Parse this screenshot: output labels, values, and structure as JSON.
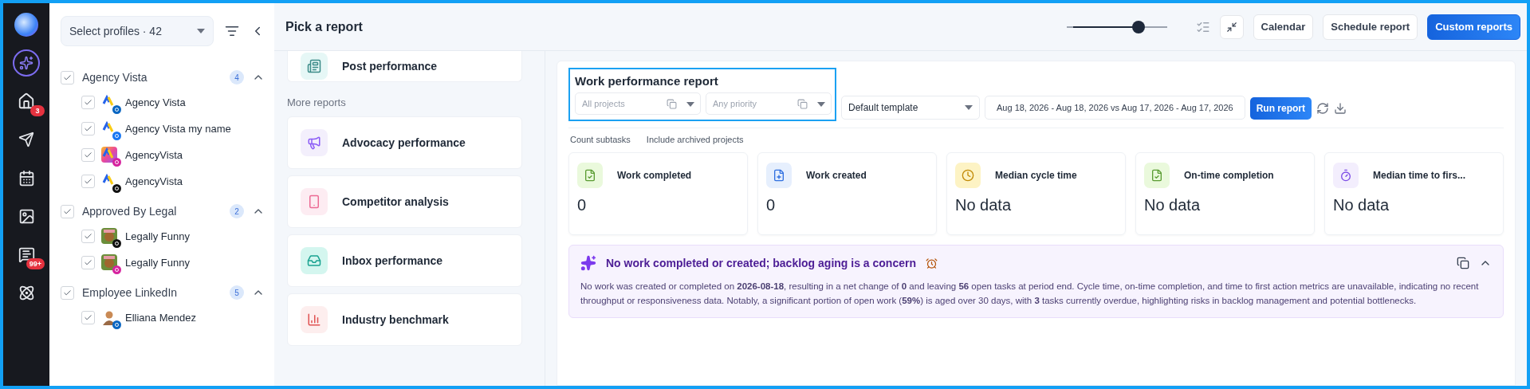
{
  "nav_rail": {
    "items": [
      {
        "kind": "logo",
        "selected": false
      },
      {
        "kind": "assistant",
        "selected": true
      },
      {
        "kind": "home",
        "selected": false,
        "badge": "3"
      },
      {
        "kind": "publish",
        "selected": false
      },
      {
        "kind": "calendar",
        "selected": false
      },
      {
        "kind": "media",
        "selected": false
      },
      {
        "kind": "inbox",
        "selected": false,
        "badge": "99+"
      },
      {
        "kind": "integrations",
        "selected": false
      }
    ]
  },
  "profiles": {
    "selector": "Select profiles · 42",
    "groups": [
      {
        "name": "Agency Vista",
        "count": "4",
        "checked": true,
        "expanded": true,
        "children": [
          {
            "name": "Agency Vista",
            "checked": true,
            "avatar": {
              "kind": "logo"
            },
            "network": {
              "kind": "linkedin"
            }
          },
          {
            "name": "Agency Vista my name",
            "checked": true,
            "avatar": {
              "kind": "logo"
            },
            "network": {
              "kind": "facebook"
            }
          },
          {
            "name": "AgencyVista",
            "checked": true,
            "avatar": {
              "kind": "gradient"
            },
            "network": {
              "kind": "instagram"
            }
          },
          {
            "name": "AgencyVista",
            "checked": true,
            "avatar": {
              "kind": "logo"
            },
            "network": {
              "kind": "x"
            }
          }
        ]
      },
      {
        "name": "Approved By Legal",
        "count": "2",
        "checked": true,
        "expanded": true,
        "children": [
          {
            "name": "Legally Funny",
            "checked": true,
            "avatar": {
              "kind": "photo"
            },
            "network": {
              "kind": "tiktok"
            }
          },
          {
            "name": "Legally Funny",
            "checked": true,
            "avatar": {
              "kind": "photo"
            },
            "network": {
              "kind": "instagram"
            }
          }
        ]
      },
      {
        "name": "Employee LinkedIn",
        "count": "5",
        "checked": true,
        "expanded": true,
        "children": [
          {
            "name": "Elliana Mendez",
            "checked": true,
            "avatar": {
              "kind": "person"
            },
            "network": {
              "kind": "linkedin"
            }
          }
        ]
      }
    ]
  },
  "header": {
    "title": "Pick a report",
    "zoom": {
      "level": 0.75
    },
    "buttons": [
      {
        "label": "Calendar",
        "kind": "secondary"
      },
      {
        "label": "Schedule report",
        "kind": "secondary"
      },
      {
        "label": "Custom reports",
        "kind": "primary"
      }
    ]
  },
  "report_list": {
    "top_report": {
      "title": "Post performance",
      "kind": "post"
    },
    "section": "More reports",
    "reports": [
      {
        "title": "Advocacy performance",
        "kind": "advocacy"
      },
      {
        "title": "Competitor analysis",
        "kind": "competitor"
      },
      {
        "title": "Inbox performance",
        "kind": "inbox"
      },
      {
        "title": "Industry benchmark",
        "kind": "benchmark"
      }
    ]
  },
  "report": {
    "title": "Work performance report",
    "filters": [
      {
        "placeholder": "All projects"
      },
      {
        "placeholder": "Any priority"
      }
    ],
    "template": "Default template",
    "date_range": "Aug 18, 2026 - Aug 18, 2026 vs Aug 17, 2026 - Aug 17, 2026",
    "run_button": "Run report",
    "options": [
      "Count subtasks",
      "Include archived projects"
    ],
    "metrics": [
      {
        "label": "Work completed",
        "value": "0",
        "kind": "completed"
      },
      {
        "label": "Work created",
        "value": "0",
        "kind": "created"
      },
      {
        "label": "Median cycle time",
        "value": "No data",
        "kind": "cycle"
      },
      {
        "label": "On-time completion",
        "value": "No data",
        "kind": "ontime"
      },
      {
        "label": "Median time to firs...",
        "value": "No data",
        "kind": "first_action"
      }
    ],
    "summary": {
      "title": "No work completed or created; backlog aging is a concern",
      "expanded": true,
      "text": "No work was created or completed on **2026-08-18**, resulting in a net change of **0** and leaving **56** open tasks at period end. Cycle time, on-time completion, and time to first action metrics are unavailable, indicating no recent throughput or responsiveness data. Notably, a significant portion of open work (**59%**) is aged over 30 days, with **3** tasks currently overdue, highlighting risks in backlog management and potential bottlenecks."
    }
  }
}
